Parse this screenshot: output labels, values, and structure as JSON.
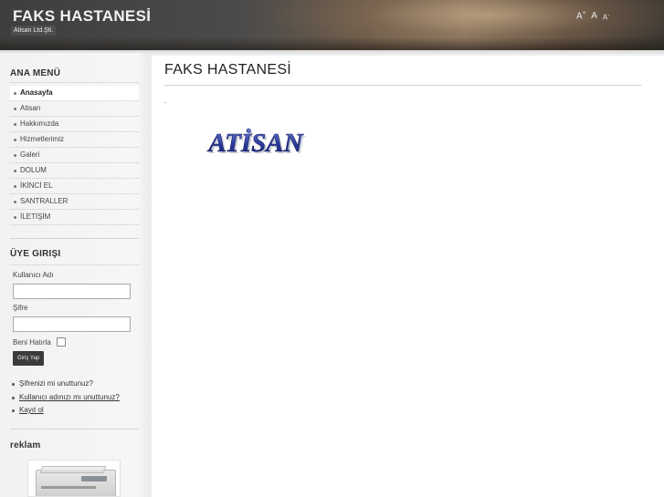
{
  "header": {
    "site_title": "FAKS HASTANESİ",
    "tagline": "Atisan Ltd.Şti.",
    "font_resizer": {
      "increase_label": "A",
      "reset_label": "A",
      "decrease_label": "A",
      "increase_suffix": "+",
      "decrease_suffix": "-"
    }
  },
  "sidebar": {
    "main_menu": {
      "title": "ANA MENÜ",
      "items": [
        {
          "label": "Anasayfa",
          "active": true
        },
        {
          "label": "Atisan"
        },
        {
          "label": "Hakkımızda"
        },
        {
          "label": "Hizmetlerimiz"
        },
        {
          "label": "Galeri"
        },
        {
          "label": "DOLUM"
        },
        {
          "label": "İKİNCİ EL"
        },
        {
          "label": "SANTRALLER"
        },
        {
          "label": "İLETİŞİM"
        }
      ]
    },
    "login": {
      "title": "ÜYE GIRIŞI",
      "username_label": "Kullanıcı Adı",
      "username_value": "",
      "password_label": "Şifre",
      "password_value": "",
      "remember_label": "Beni Hatırla",
      "remember_checked": false,
      "submit_label": "Giriş Yap",
      "links": [
        {
          "label": "Şifrenizi mi unuttunuz?",
          "underlined": false
        },
        {
          "label": "Kullanıcı adınızı mı unuttunuz?",
          "underlined": true
        },
        {
          "label": "Kayıt ol",
          "underlined": true
        }
      ]
    },
    "ad": {
      "title": "reklam"
    }
  },
  "main": {
    "page_title": "FAKS HASTANESİ",
    "body_text": ".",
    "logo_text": "ATİSAN"
  },
  "colors": {
    "header_dark": "#3e3e3e",
    "logo_blue": "#2b3a9c",
    "button_dark": "#3b3b3b"
  }
}
